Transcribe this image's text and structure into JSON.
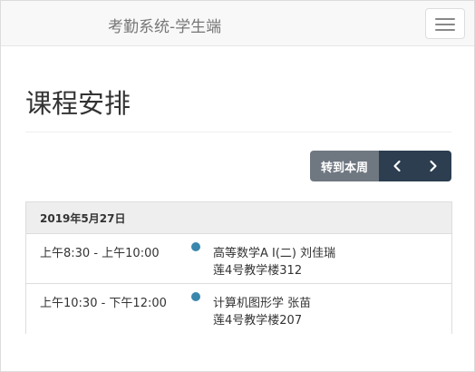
{
  "navbar": {
    "brand": "考勤系统-学生端",
    "menu_icon": "hamburger-menu-icon"
  },
  "page": {
    "title": "课程安排"
  },
  "toolbar": {
    "today_label": "转到本周",
    "prev_icon": "chevron-left-icon",
    "next_icon": "chevron-right-icon"
  },
  "agenda": {
    "date": "2019年5月27日",
    "events": [
      {
        "time": "上午8:30 - 上午10:00",
        "title": "高等数学A Ⅰ(二) 刘佳瑞",
        "location": "莲4号教学楼312",
        "color": "#3a87ad"
      },
      {
        "time": "上午10:30 - 下午12:00",
        "title": "计算机图形学 张苗",
        "location": "莲4号教学楼207",
        "color": "#3a87ad"
      }
    ]
  },
  "colors": {
    "accent": "#3a87ad",
    "button_dark": "#2c3e50",
    "button_gray": "#6f7781"
  }
}
